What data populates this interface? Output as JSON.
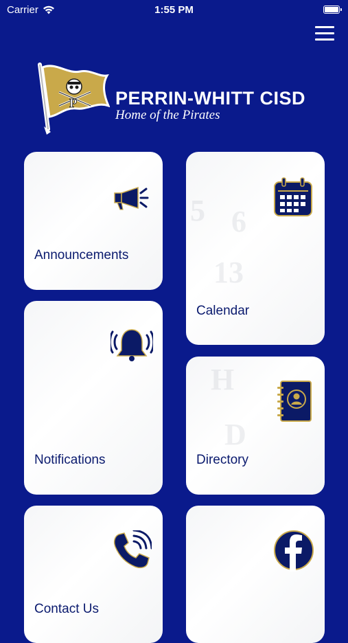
{
  "status_bar": {
    "carrier": "Carrier",
    "time": "1:55 PM"
  },
  "header": {
    "title": "PERRIN-WHITT CISD",
    "subtitle": "Home of the Pirates"
  },
  "tiles": [
    {
      "label": "Announcements",
      "icon": "megaphone-icon"
    },
    {
      "label": "Calendar",
      "icon": "calendar-icon"
    },
    {
      "label": "Notifications",
      "icon": "bell-icon"
    },
    {
      "label": "Directory",
      "icon": "contact-book-icon"
    },
    {
      "label": "Contact Us",
      "icon": "phone-icon"
    },
    {
      "label": "",
      "icon": "facebook-icon"
    }
  ],
  "colors": {
    "background": "#0a1a8c",
    "icon_navy": "#0b1a66",
    "icon_gold": "#c9a94a"
  }
}
